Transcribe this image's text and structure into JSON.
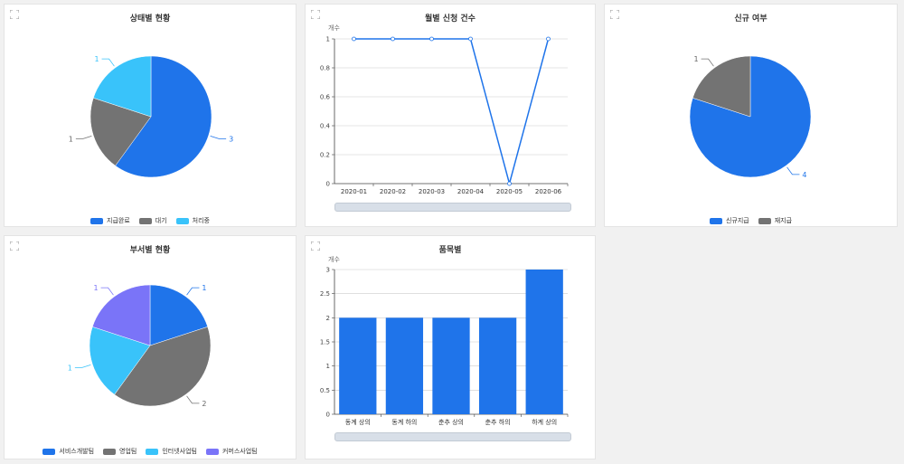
{
  "colors": {
    "blue": "#1f74ea",
    "gray": "#737373",
    "cyan": "#39c3fa",
    "purple": "#7a74f8"
  },
  "panels": {
    "status": {
      "title": "상태별 현황"
    },
    "monthly": {
      "title": "월별 신청 건수",
      "unit": "개수"
    },
    "newness": {
      "title": "신규 여부"
    },
    "dept": {
      "title": "부서별 현황"
    },
    "item": {
      "title": "품목별",
      "unit": "개수"
    }
  },
  "chart_data": [
    {
      "id": "status",
      "type": "pie",
      "title": "상태별 현황",
      "labels": [
        "지급완료",
        "대기",
        "처리중"
      ],
      "values": [
        3,
        1,
        1
      ],
      "colors": [
        "#1f74ea",
        "#737373",
        "#39c3fa"
      ],
      "legend": "bottom"
    },
    {
      "id": "monthly",
      "type": "line",
      "title": "월별 신청 건수",
      "ylabel": "개수",
      "x": [
        "2020-01",
        "2020-02",
        "2020-03",
        "2020-04",
        "2020-05",
        "2020-06"
      ],
      "values": [
        1,
        1,
        1,
        1,
        0,
        1
      ],
      "ylim": [
        0,
        1
      ],
      "yticks": [
        "0",
        "0.2",
        "0.4",
        "0.6",
        "0.8",
        "1"
      ],
      "color": "#1f74ea",
      "grid": true
    },
    {
      "id": "newness",
      "type": "pie",
      "title": "신규 여부",
      "labels": [
        "신규지급",
        "재지급"
      ],
      "values": [
        4,
        1
      ],
      "colors": [
        "#1f74ea",
        "#737373"
      ],
      "legend": "bottom"
    },
    {
      "id": "dept",
      "type": "pie",
      "title": "부서별 현황",
      "labels": [
        "서비스개발팀",
        "영업팀",
        "인터넷사업팀",
        "커머스사업팀"
      ],
      "values": [
        1,
        2,
        1,
        1
      ],
      "colors": [
        "#1f74ea",
        "#737373",
        "#39c3fa",
        "#7a74f8"
      ],
      "legend": "bottom"
    },
    {
      "id": "item",
      "type": "bar",
      "title": "품목별",
      "ylabel": "개수",
      "categories": [
        "동계 상의",
        "동계 하의",
        "춘추 상의",
        "춘추 하의",
        "하계 상의"
      ],
      "values": [
        2,
        2,
        2,
        2,
        3
      ],
      "ylim": [
        0,
        3
      ],
      "yticks": [
        "0",
        "0.5",
        "1",
        "1.5",
        "2",
        "2.5",
        "3"
      ],
      "color": "#1f74ea",
      "grid": true
    }
  ]
}
